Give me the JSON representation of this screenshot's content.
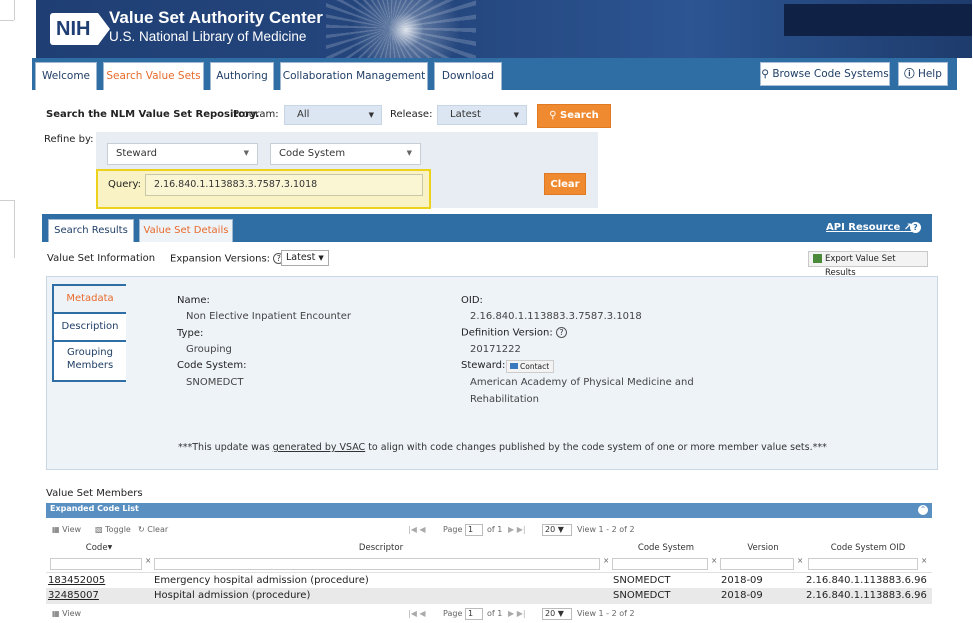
{
  "header": {
    "logo": "NIH",
    "title": "Value Set Authority Center",
    "subtitle": "U.S. National Library of Medicine"
  },
  "nav": {
    "tabs": [
      "Welcome",
      "Search Value Sets",
      "Authoring",
      "Collaboration Management",
      "Download"
    ],
    "active_tab": "Search Value Sets",
    "browse": "Browse Code Systems",
    "help": "Help"
  },
  "search": {
    "label": "Search the NLM Value Set Repository.",
    "program_label": "Program:",
    "program_value": "All",
    "release_label": "Release:",
    "release_value": "Latest",
    "search_button": "Search",
    "refine_label": "Refine by:",
    "steward_value": "Steward",
    "codesys_value": "Code System",
    "query_label": "Query:",
    "query_value": "2.16.840.1.113883.3.7587.3.1018",
    "clear_button": "Clear"
  },
  "results": {
    "tabs": [
      "Search Results",
      "Value Set Details"
    ],
    "active_tab": "Value Set Details",
    "api": "API Resource"
  },
  "info": {
    "title": "Value Set Information",
    "expansion_label": "Expansion Versions:",
    "expansion_value": "Latest",
    "export": "Export Value Set Results"
  },
  "side_tabs": [
    "Metadata",
    "Description",
    "Grouping Members"
  ],
  "metadata": {
    "name_label": "Name:",
    "name": "Non Elective Inpatient Encounter",
    "type_label": "Type:",
    "type": "Grouping",
    "codesys_label": "Code System:",
    "codesys": "SNOMEDCT",
    "oid_label": "OID:",
    "oid": "2.16.840.1.113883.3.7587.3.1018",
    "defver_label": "Definition Version:",
    "defver": "20171222",
    "steward_label": "Steward:",
    "contact": "Contact",
    "steward_line1": "American Academy of Physical Medicine and",
    "steward_line2": "Rehabilitation",
    "note_pre": "***This update was ",
    "note_link": "generated by VSAC",
    "note_post": " to align with code changes published by the code system of one or more member value sets.***"
  },
  "members": {
    "title": "Value Set Members",
    "bar": "Expanded Code List",
    "view": "View",
    "toggle": "Toggle",
    "clear": "Clear",
    "page": "Page",
    "page_value": "1",
    "of": "of 1",
    "per_page": "20",
    "view_range": "View 1 - 2 of 2",
    "columns": [
      "Code",
      "Descriptor",
      "Code System",
      "Version",
      "Code System OID"
    ],
    "rows": [
      {
        "code": "183452005",
        "descriptor": "Emergency hospital admission (procedure)",
        "system": "SNOMEDCT",
        "version": "2018-09",
        "oid": "2.16.840.1.113883.6.96"
      },
      {
        "code": "32485007",
        "descriptor": "Hospital admission (procedure)",
        "system": "SNOMEDCT",
        "version": "2018-09",
        "oid": "2.16.840.1.113883.6.96"
      }
    ]
  },
  "colors": {
    "nav_blue": "#2f6ea5",
    "accent_orange": "#f08a30",
    "highlight_yellow": "#ecd21c"
  }
}
